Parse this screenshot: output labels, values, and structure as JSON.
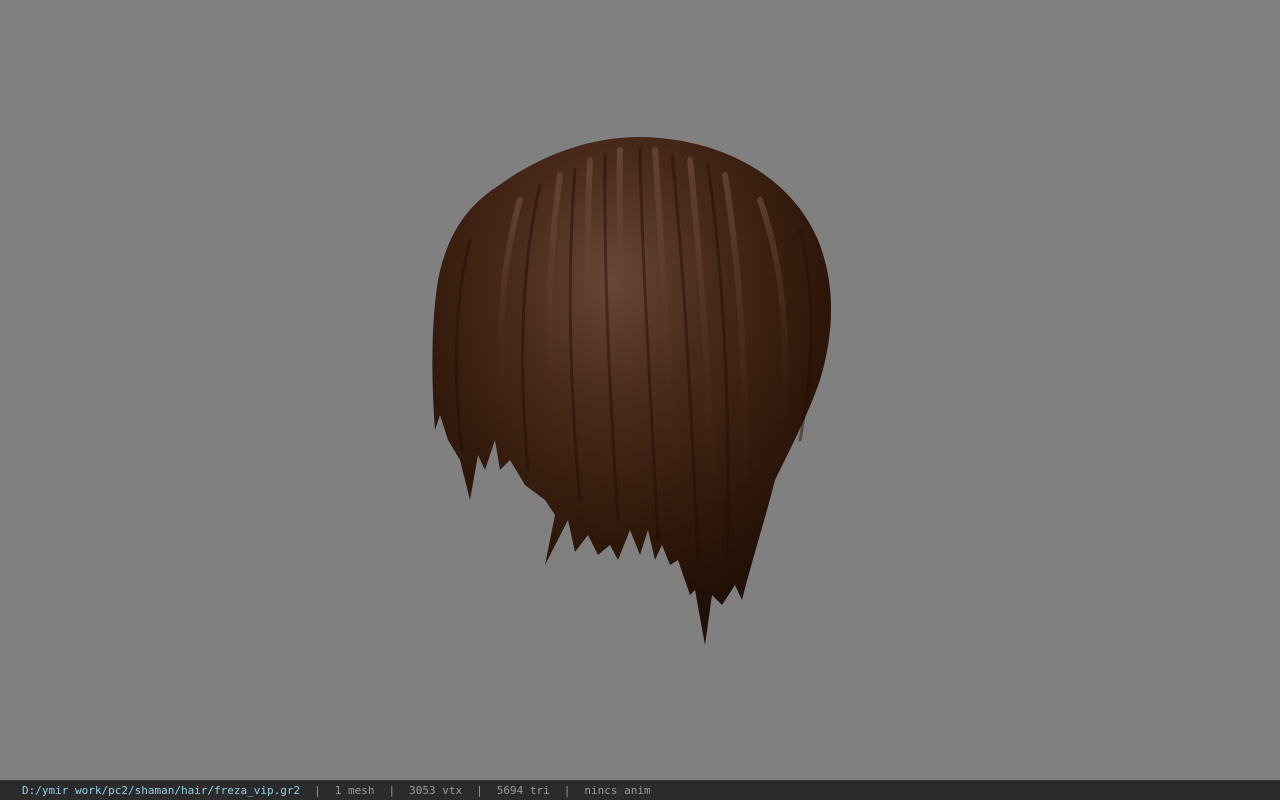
{
  "viewer": {
    "background_color": "#808080",
    "model_color": "#3a2113",
    "model_highlight_color": "#6a4a3a"
  },
  "status_bar": {
    "file_path": "D:/ymir work/pc2/shaman/hair/freza_vip.gr2",
    "separator": "|",
    "mesh_count": "1 mesh",
    "vertex_count": "3053 vtx",
    "triangle_count": "5694 tri",
    "animation": "nincs anim"
  }
}
